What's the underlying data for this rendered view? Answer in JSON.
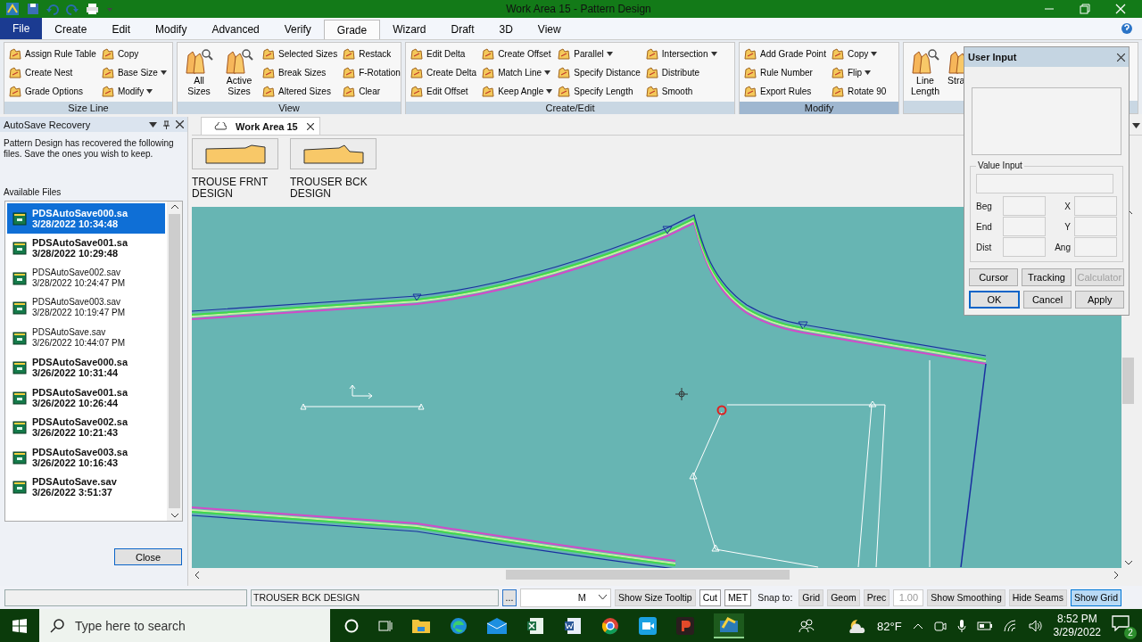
{
  "window": {
    "title": "Work Area 15 - Pattern Design"
  },
  "menu_tabs": [
    {
      "label": "File",
      "kind": "file",
      "selected": false
    },
    {
      "label": "Create",
      "kind": "tab",
      "selected": false
    },
    {
      "label": "Edit",
      "kind": "tab",
      "selected": false
    },
    {
      "label": "Modify",
      "kind": "tab",
      "selected": false
    },
    {
      "label": "Advanced",
      "kind": "tab",
      "selected": false
    },
    {
      "label": "Verify",
      "kind": "tab",
      "selected": false
    },
    {
      "label": "Grade",
      "kind": "tab",
      "selected": true
    },
    {
      "label": "Wizard",
      "kind": "tab",
      "selected": false
    },
    {
      "label": "Draft",
      "kind": "tab",
      "selected": false
    },
    {
      "label": "3D",
      "kind": "tab",
      "selected": false
    },
    {
      "label": "View",
      "kind": "tab",
      "selected": false
    }
  ],
  "ribbon": {
    "groups": [
      {
        "label": "Size Line",
        "highlighted": false,
        "columns": [
          [
            {
              "label": "Assign Rule Table",
              "kind": "small",
              "dropdown": false
            },
            {
              "label": "Create Nest",
              "kind": "small",
              "dropdown": false
            },
            {
              "label": "Grade Options",
              "kind": "small",
              "dropdown": false
            }
          ],
          [
            {
              "label": "Copy",
              "kind": "small",
              "dropdown": false
            },
            {
              "label": "Base Size",
              "kind": "small",
              "dropdown": true
            },
            {
              "label": "Modify",
              "kind": "small",
              "dropdown": true
            }
          ]
        ]
      },
      {
        "label": "View",
        "highlighted": false,
        "columns": [
          [
            {
              "label": "All Sizes",
              "kind": "large",
              "dropdown": false
            }
          ],
          [
            {
              "label": "Active Sizes",
              "kind": "large",
              "dropdown": false
            }
          ],
          [
            {
              "label": "Selected Sizes",
              "kind": "small",
              "dropdown": false
            },
            {
              "label": "Break Sizes",
              "kind": "small",
              "dropdown": false
            },
            {
              "label": "Altered Sizes",
              "kind": "small",
              "dropdown": false
            }
          ],
          [
            {
              "label": "Restack",
              "kind": "small",
              "dropdown": false
            },
            {
              "label": "F-Rotation",
              "kind": "small",
              "dropdown": false
            },
            {
              "label": "Clear",
              "kind": "small",
              "dropdown": false
            }
          ]
        ]
      },
      {
        "label": "Create/Edit",
        "highlighted": false,
        "columns": [
          [
            {
              "label": "Edit Delta",
              "kind": "small",
              "dropdown": false
            },
            {
              "label": "Create Delta",
              "kind": "small",
              "dropdown": false
            },
            {
              "label": "Edit Offset",
              "kind": "small",
              "dropdown": false
            }
          ],
          [
            {
              "label": "Create Offset",
              "kind": "small",
              "dropdown": false
            },
            {
              "label": "Match Line",
              "kind": "small",
              "dropdown": true
            },
            {
              "label": "Keep Angle",
              "kind": "small",
              "dropdown": true
            }
          ],
          [
            {
              "label": "Parallel",
              "kind": "small",
              "dropdown": true
            },
            {
              "label": "Specify Distance",
              "kind": "small",
              "dropdown": false
            },
            {
              "label": "Specify Length",
              "kind": "small",
              "dropdown": false
            }
          ],
          [
            {
              "label": "Intersection",
              "kind": "small",
              "dropdown": true
            },
            {
              "label": "Distribute",
              "kind": "small",
              "dropdown": false
            },
            {
              "label": "Smooth",
              "kind": "small",
              "dropdown": false
            }
          ]
        ]
      },
      {
        "label": "Modify",
        "highlighted": true,
        "columns": [
          [
            {
              "label": "Add Grade Point",
              "kind": "small",
              "dropdown": false
            },
            {
              "label": "Rule Number",
              "kind": "small",
              "dropdown": false
            },
            {
              "label": "Export Rules",
              "kind": "small",
              "dropdown": false
            }
          ],
          [
            {
              "label": "Copy",
              "kind": "small",
              "dropdown": true
            },
            {
              "label": "Flip",
              "kind": "small",
              "dropdown": true
            },
            {
              "label": "Rotate 90",
              "kind": "small",
              "dropdown": false
            }
          ]
        ]
      },
      {
        "columns": [
          [
            {
              "label": "Line Length",
              "kind": "large",
              "dropdown": false
            }
          ],
          [
            {
              "label": "Stra",
              "kind": "large",
              "dropdown": false
            }
          ]
        ]
      }
    ]
  },
  "autosave_panel": {
    "title": "AutoSave Recovery",
    "message": "Pattern Design has recovered the following files. Save the ones you wish to keep.",
    "list_label": "Available Files",
    "files": [
      {
        "name": "PDSAutoSave000.sa",
        "date": "3/28/2022 10:34:48",
        "bold": true,
        "selected": true
      },
      {
        "name": "PDSAutoSave001.sa",
        "date": "3/28/2022 10:29:48",
        "bold": true,
        "selected": false
      },
      {
        "name": "PDSAutoSave002.sav",
        "date": "3/28/2022 10:24:47 PM",
        "bold": false,
        "selected": false
      },
      {
        "name": "PDSAutoSave003.sav",
        "date": "3/28/2022 10:19:47 PM",
        "bold": false,
        "selected": false
      },
      {
        "name": "PDSAutoSave.sav",
        "date": "3/26/2022 10:44:07 PM",
        "bold": false,
        "selected": false
      },
      {
        "name": "PDSAutoSave000.sa",
        "date": "3/26/2022 10:31:44",
        "bold": true,
        "selected": false
      },
      {
        "name": "PDSAutoSave001.sa",
        "date": "3/26/2022 10:26:44",
        "bold": true,
        "selected": false
      },
      {
        "name": "PDSAutoSave002.sa",
        "date": "3/26/2022 10:21:43",
        "bold": true,
        "selected": false
      },
      {
        "name": "PDSAutoSave003.sa",
        "date": "3/26/2022 10:16:43",
        "bold": true,
        "selected": false
      },
      {
        "name": "PDSAutoSave.sav",
        "date": "3/26/2022 3:51:37",
        "bold": true,
        "selected": false
      }
    ],
    "close_button": "Close"
  },
  "work_area": {
    "tab": "Work Area 15",
    "pieces": [
      {
        "label": "TROUSE FRNT DESIGN"
      },
      {
        "label": "TROUSER BCK DESIGN"
      }
    ]
  },
  "user_input": {
    "title": "User Input",
    "group_label": "Value Input",
    "left_labels": [
      "Beg",
      "End",
      "Dist"
    ],
    "right_labels": [
      "X",
      "Y",
      "Ang"
    ],
    "buttons": [
      {
        "label": "Cursor",
        "disabled": false,
        "focused": false
      },
      {
        "label": "Tracking",
        "disabled": false,
        "focused": false
      },
      {
        "label": "Calculator",
        "disabled": true,
        "focused": false
      },
      {
        "label": "OK",
        "disabled": false,
        "focused": true
      },
      {
        "label": "Cancel",
        "disabled": false,
        "focused": false
      },
      {
        "label": "Apply",
        "disabled": false,
        "focused": false
      }
    ]
  },
  "status_bar": {
    "piece_field": "TROUSER BCK DESIGN",
    "more_button": "...",
    "unit_select": "M",
    "items": [
      {
        "label": "Show Size Tooltip",
        "kind": "button",
        "selected": false
      },
      {
        "label": "Cut",
        "kind": "field",
        "selected": false
      },
      {
        "label": "MET",
        "kind": "field",
        "selected": false
      },
      {
        "label": "Snap to:",
        "kind": "label"
      },
      {
        "label": "Grid",
        "kind": "button",
        "selected": false
      },
      {
        "label": "Geom",
        "kind": "button",
        "selected": false
      },
      {
        "label": "Prec",
        "kind": "button",
        "selected": false
      },
      {
        "label": "1.00",
        "kind": "value"
      },
      {
        "label": "Show Smoothing",
        "kind": "button",
        "selected": false
      },
      {
        "label": "Hide Seams",
        "kind": "button",
        "selected": false
      },
      {
        "label": "Show Grid",
        "kind": "button",
        "selected": true
      }
    ]
  },
  "taskbar": {
    "search_placeholder": "Type here to search",
    "temperature": "82°F",
    "time": "8:52 PM",
    "date": "3/29/2022",
    "notifications": "2"
  }
}
